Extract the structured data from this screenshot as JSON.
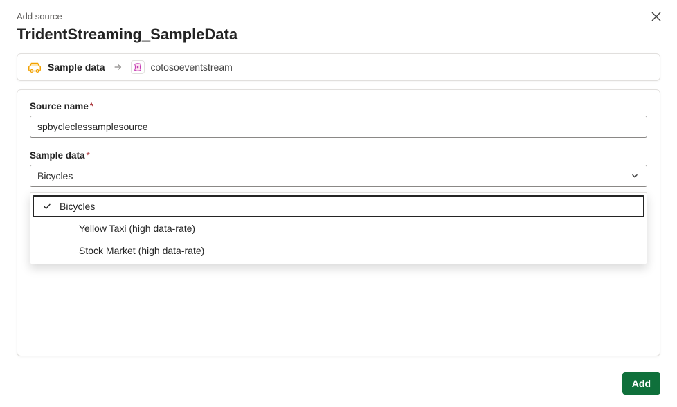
{
  "dialog": {
    "subtitle": "Add source",
    "title": "TridentStreaming_SampleData"
  },
  "breadcrumb": {
    "source_type_label": "Sample data",
    "destination_label": "cotosoeventstream"
  },
  "form": {
    "source_name": {
      "label": "Source name",
      "required_marker": "*",
      "value": "spbycleclessamplesource"
    },
    "sample_data": {
      "label": "Sample data",
      "required_marker": "*",
      "selected_value": "Bicycles",
      "options": [
        {
          "label": "Bicycles",
          "selected": true
        },
        {
          "label": "Yellow Taxi (high data-rate)",
          "selected": false
        },
        {
          "label": "Stock Market (high data-rate)",
          "selected": false
        }
      ]
    }
  },
  "footer": {
    "add_label": "Add"
  }
}
